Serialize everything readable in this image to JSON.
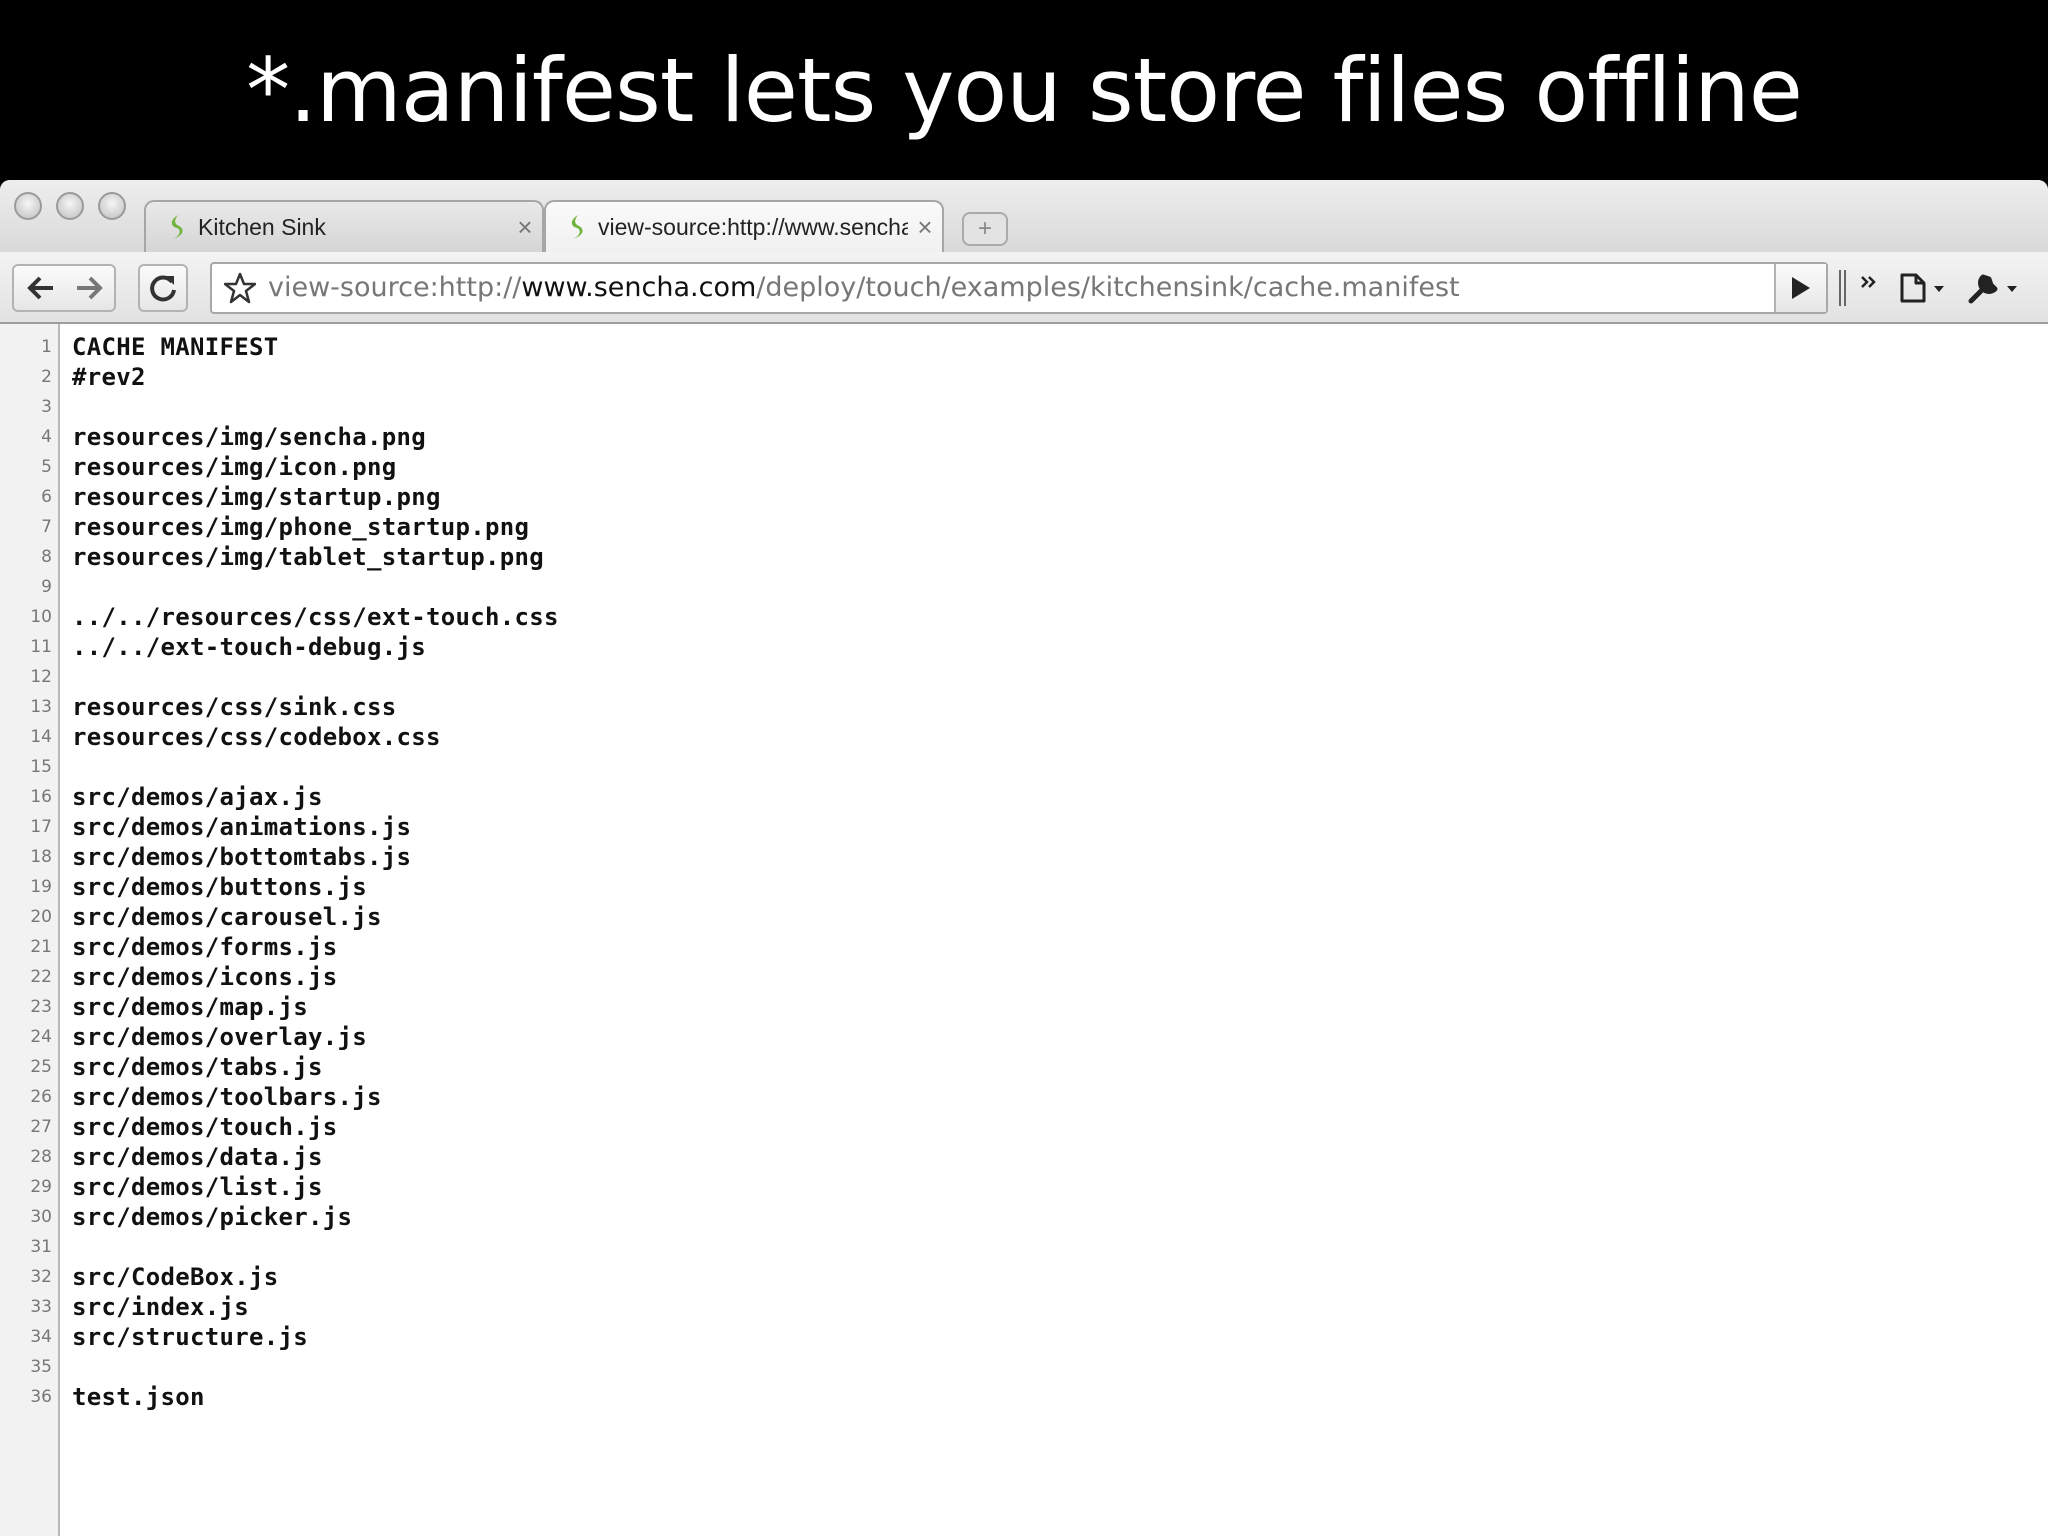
{
  "slide": {
    "title": "*.manifest lets you store files offline"
  },
  "browser": {
    "tabs": [
      {
        "label": "Kitchen Sink",
        "close": "×"
      },
      {
        "label": "view-source:http://www.sencha.com/deploy/touch/examples/kitchensink/cache.manifest",
        "close": "×"
      }
    ],
    "new_tab": "+",
    "url": {
      "prefix": "view-source:http://",
      "host": "www.sencha.com",
      "path": "/deploy/touch/examples/kitchensink/cache.manifest"
    },
    "icons": {
      "back": "back-arrow-icon",
      "forward": "forward-arrow-icon",
      "reload": "reload-icon",
      "bookmark": "star-icon",
      "go": "play-icon",
      "overflow": "chevron-double-right-icon",
      "page_menu": "page-icon",
      "wrench_menu": "wrench-icon"
    },
    "accent": "#6fb33a"
  },
  "source_lines": [
    {
      "n": "1",
      "text": "CACHE MANIFEST"
    },
    {
      "n": "2",
      "text": "#rev2"
    },
    {
      "n": "3",
      "text": ""
    },
    {
      "n": "4",
      "text": "resources/img/sencha.png"
    },
    {
      "n": "5",
      "text": "resources/img/icon.png"
    },
    {
      "n": "6",
      "text": "resources/img/startup.png"
    },
    {
      "n": "7",
      "text": "resources/img/phone_startup.png"
    },
    {
      "n": "8",
      "text": "resources/img/tablet_startup.png"
    },
    {
      "n": "9",
      "text": ""
    },
    {
      "n": "10",
      "text": "../../resources/css/ext-touch.css"
    },
    {
      "n": "11",
      "text": "../../ext-touch-debug.js"
    },
    {
      "n": "12",
      "text": ""
    },
    {
      "n": "13",
      "text": "resources/css/sink.css"
    },
    {
      "n": "14",
      "text": "resources/css/codebox.css"
    },
    {
      "n": "15",
      "text": ""
    },
    {
      "n": "16",
      "text": "src/demos/ajax.js"
    },
    {
      "n": "17",
      "text": "src/demos/animations.js"
    },
    {
      "n": "18",
      "text": "src/demos/bottomtabs.js"
    },
    {
      "n": "19",
      "text": "src/demos/buttons.js"
    },
    {
      "n": "20",
      "text": "src/demos/carousel.js"
    },
    {
      "n": "21",
      "text": "src/demos/forms.js"
    },
    {
      "n": "22",
      "text": "src/demos/icons.js"
    },
    {
      "n": "23",
      "text": "src/demos/map.js"
    },
    {
      "n": "24",
      "text": "src/demos/overlay.js"
    },
    {
      "n": "25",
      "text": "src/demos/tabs.js"
    },
    {
      "n": "26",
      "text": "src/demos/toolbars.js"
    },
    {
      "n": "27",
      "text": "src/demos/touch.js"
    },
    {
      "n": "28",
      "text": "src/demos/data.js"
    },
    {
      "n": "29",
      "text": "src/demos/list.js"
    },
    {
      "n": "30",
      "text": "src/demos/picker.js"
    },
    {
      "n": "31",
      "text": ""
    },
    {
      "n": "32",
      "text": "src/CodeBox.js"
    },
    {
      "n": "33",
      "text": "src/index.js"
    },
    {
      "n": "34",
      "text": "src/structure.js"
    },
    {
      "n": "35",
      "text": ""
    },
    {
      "n": "36",
      "text": "test.json"
    }
  ]
}
